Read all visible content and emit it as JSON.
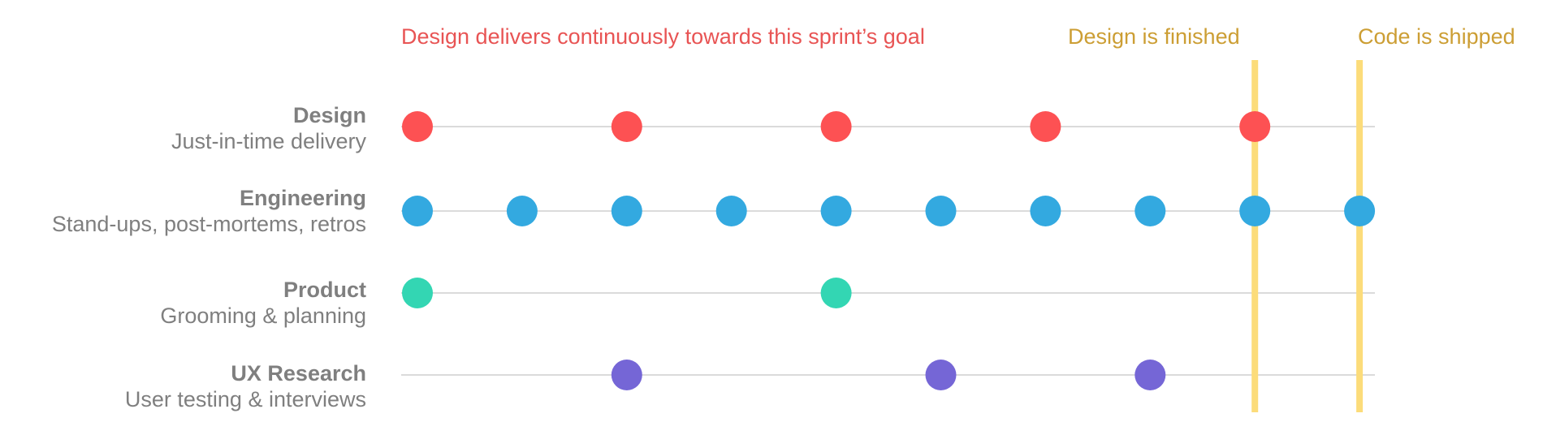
{
  "header": {
    "sprint_goal_note": "Design delivers continuously towards this sprint’s goal",
    "design_finished_marker": "Design is finished",
    "code_shipped_marker": "Code is shipped"
  },
  "lanes": [
    {
      "title": "Design",
      "subtitle": "Just-in-time delivery",
      "color": "#fd5153",
      "points": [
        0,
        2,
        4,
        6,
        8
      ]
    },
    {
      "title": "Engineering",
      "subtitle": "Stand-ups, post-mortems, retros",
      "color": "#33a9e0",
      "points": [
        0,
        1,
        2,
        3,
        4,
        5,
        6,
        7,
        8,
        9
      ]
    },
    {
      "title": "Product",
      "subtitle": "Grooming & planning",
      "color": "#33d6b3",
      "points": [
        0,
        4
      ]
    },
    {
      "title": "UX Research",
      "subtitle": "User testing & interviews",
      "color": "#7566d6",
      "points": [
        2,
        5,
        7
      ]
    }
  ],
  "milestones": [
    {
      "slot": 8,
      "color": "#fcdc7a"
    },
    {
      "slot": 9,
      "color": "#fcdc7a"
    }
  ],
  "colors": {
    "sprint_goal_note": "#e85454",
    "milestone_text": "#cc9e34",
    "label_text": "#7f7f7f",
    "track_line": "#cfcfcf"
  }
}
